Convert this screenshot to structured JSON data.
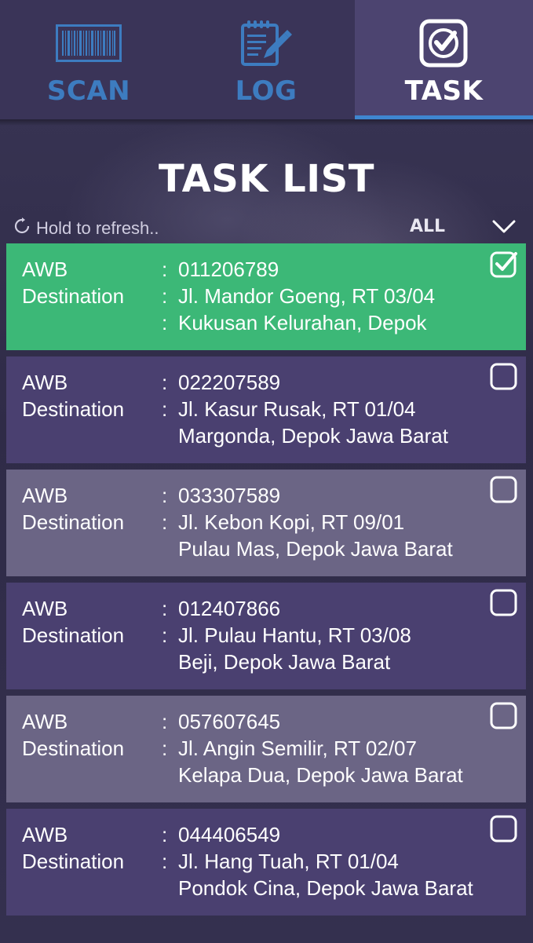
{
  "tabs": [
    {
      "label": "SCAN",
      "icon": "barcode-icon",
      "active": false
    },
    {
      "label": "LOG",
      "icon": "notepad-pencil-icon",
      "active": false
    },
    {
      "label": "TASK",
      "icon": "checkbox-icon",
      "active": true
    }
  ],
  "colors": {
    "accent_blue": "#3d7cc0",
    "selected_card": "#3cb877",
    "card_dark": "#4a4070",
    "card_light": "#6b6585"
  },
  "page": {
    "title": "TASK LIST",
    "refresh_hint": "Hold to refresh..",
    "filter_value": "ALL"
  },
  "field_labels": {
    "awb": "AWB",
    "destination": "Destination",
    "separator": ":"
  },
  "tasks": [
    {
      "awb": "011206789",
      "line1": "Jl. Mandor Goeng, RT 03/04",
      "line2": "Kukusan Kelurahan, Depok",
      "checked": true,
      "line2_colon": true
    },
    {
      "awb": "022207589",
      "line1": "Jl. Kasur Rusak, RT 01/04",
      "line2": "Margonda, Depok Jawa Barat",
      "checked": false,
      "line2_colon": false
    },
    {
      "awb": "033307589",
      "line1": "Jl. Kebon Kopi, RT 09/01",
      "line2": "Pulau Mas, Depok Jawa Barat",
      "checked": false,
      "line2_colon": false
    },
    {
      "awb": "012407866",
      "line1": "Jl. Pulau Hantu, RT 03/08",
      "line2": "Beji, Depok Jawa Barat",
      "checked": false,
      "line2_colon": false
    },
    {
      "awb": "057607645",
      "line1": "Jl. Angin Semilir, RT 02/07",
      "line2": "Kelapa Dua, Depok Jawa Barat",
      "checked": false,
      "line2_colon": false
    },
    {
      "awb": "044406549",
      "line1": "Jl. Hang Tuah, RT 01/04",
      "line2": "Pondok Cina, Depok Jawa Barat",
      "checked": false,
      "line2_colon": false
    }
  ]
}
